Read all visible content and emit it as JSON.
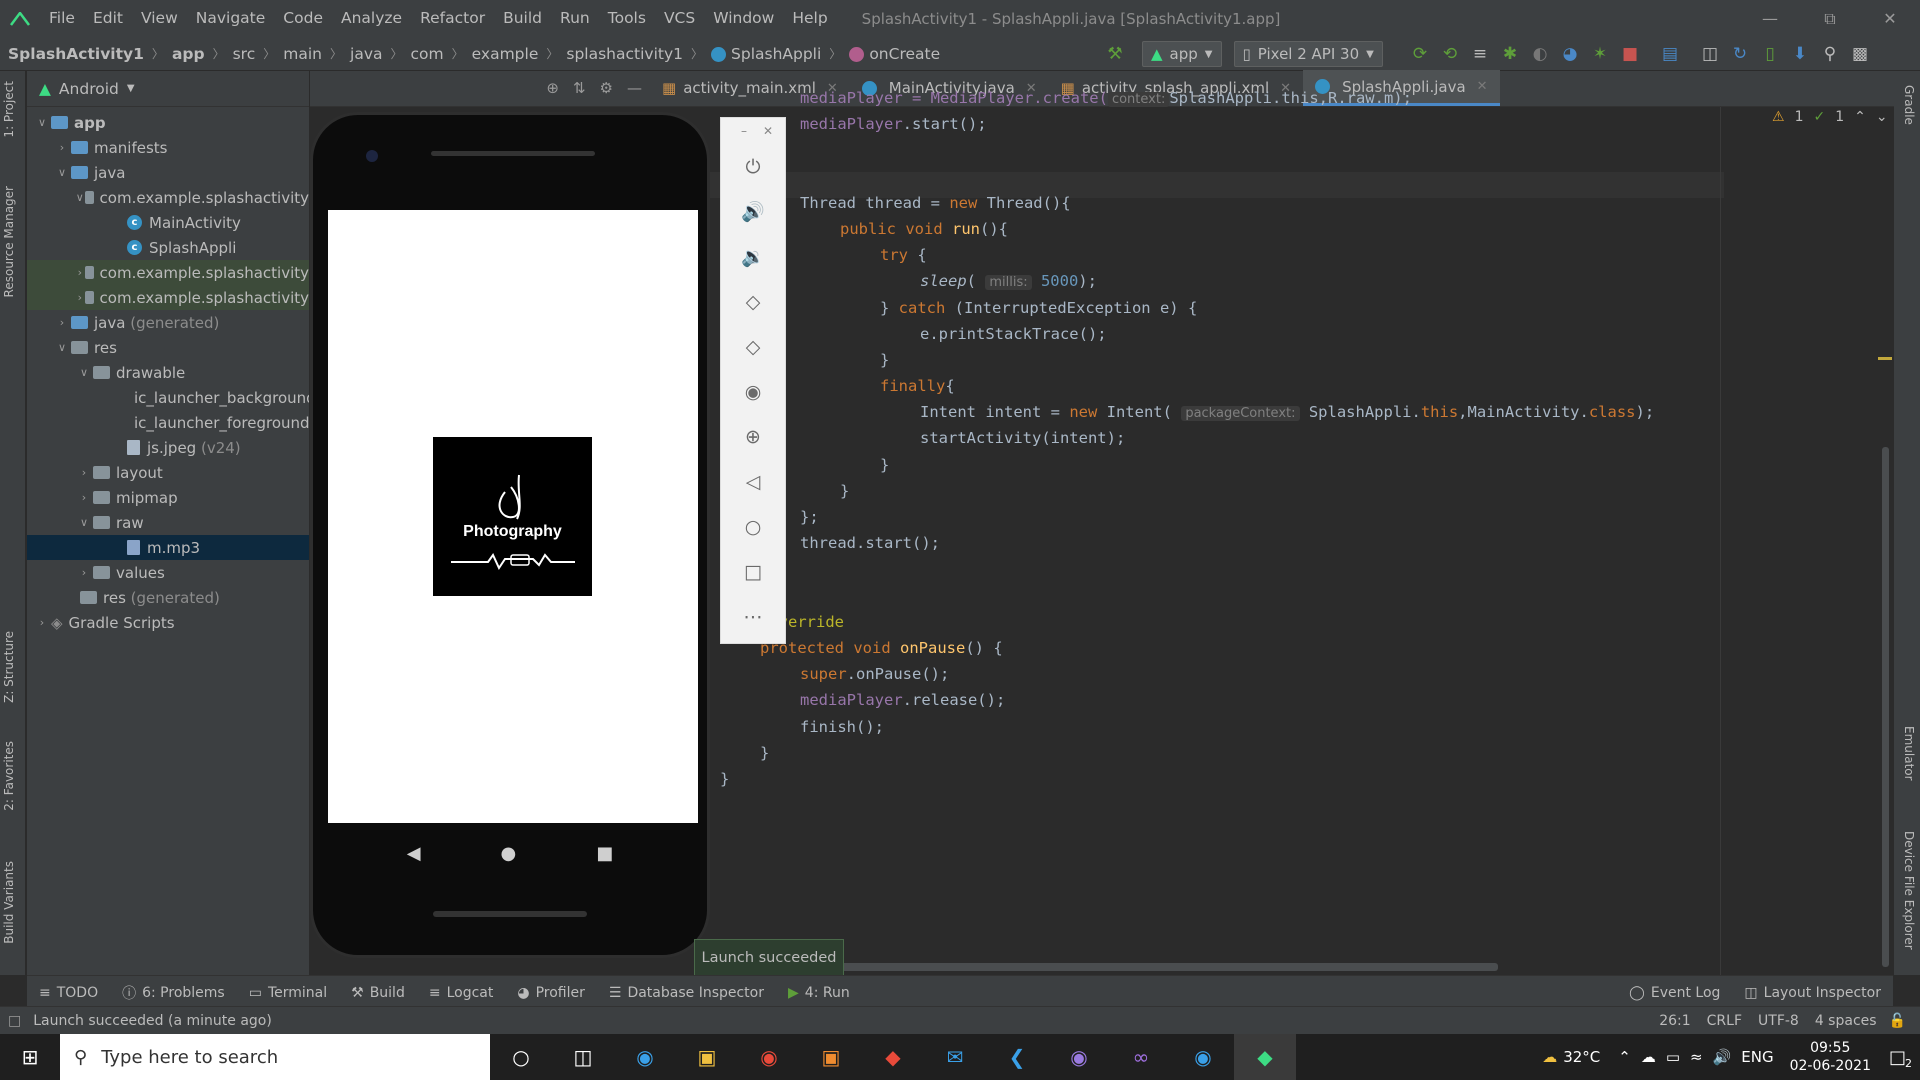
{
  "app": {
    "title": "SplashActivity1 - SplashAppli.java [SplashActivity1.app]"
  },
  "menu": [
    "File",
    "Edit",
    "View",
    "Navigate",
    "Code",
    "Analyze",
    "Refactor",
    "Build",
    "Run",
    "Tools",
    "VCS",
    "Window",
    "Help"
  ],
  "breadcrumb": [
    "SplashActivity1",
    "app",
    "src",
    "main",
    "java",
    "com",
    "example",
    "splashactivity1",
    "SplashAppli",
    "onCreate"
  ],
  "toolbar": {
    "config": "app",
    "device": "Pixel 2 API 30"
  },
  "project": {
    "view_label": "Android",
    "tree": [
      {
        "label": "app"
      },
      {
        "label": "manifests"
      },
      {
        "label": "java"
      },
      {
        "label": "com.example.splashactivity"
      },
      {
        "label": "MainActivity"
      },
      {
        "label": "SplashAppli"
      },
      {
        "label": "com.example.splashactivity"
      },
      {
        "label": "com.example.splashactivity"
      },
      {
        "label": "java",
        "suffix": "(generated)"
      },
      {
        "label": "res"
      },
      {
        "label": "drawable"
      },
      {
        "label": "ic_launcher_background"
      },
      {
        "label": "ic_launcher_foreground.:"
      },
      {
        "label": "js.jpeg",
        "suffix": "(v24)"
      },
      {
        "label": "layout"
      },
      {
        "label": "mipmap"
      },
      {
        "label": "raw"
      },
      {
        "label": "m.mp3"
      },
      {
        "label": "values"
      },
      {
        "label": "res",
        "suffix": "(generated)"
      },
      {
        "label": "Gradle Scripts"
      }
    ]
  },
  "tabs": [
    "activity_main.xml",
    "MainActivity.java",
    "activity_splash_appli.xml",
    "SplashAppli.java"
  ],
  "code": {
    "line0": "mediaPlayer = MediaPlayer.create(",
    "hint_context": "context:",
    "line0b": "SplashAppli.this,R.raw.m);",
    "line1": "mediaPlayer.start();",
    "hint_millis": "millis:",
    "hint_pkg": "packageContext:"
  },
  "inspections": {
    "warnings": "1",
    "checks": "1"
  },
  "emulator": {
    "screen_text": "Photography"
  },
  "bottom_tabs": [
    "TODO",
    "6: Problems",
    "Terminal",
    "Build",
    "Logcat",
    "Profiler",
    "Database Inspector",
    "4: Run",
    "Event Log",
    "Layout Inspector"
  ],
  "toast": "Launch succeeded",
  "status": {
    "message": "Launch succeeded (a minute ago)",
    "position": "26:1",
    "line_sep": "CRLF",
    "encoding": "UTF-8",
    "indent": "4 spaces"
  },
  "left_tabs": [
    "1: Project",
    "Resource Manager",
    "Z: Structure",
    "2: Favorites",
    "Build Variants"
  ],
  "right_tabs": [
    "Gradle",
    "Emulator",
    "Device File Explorer"
  ],
  "taskbar": {
    "search_placeholder": "Type here to search",
    "temperature": "32°C",
    "lang": "ENG",
    "time": "09:55",
    "date": "02-06-2021",
    "notif": "2"
  }
}
